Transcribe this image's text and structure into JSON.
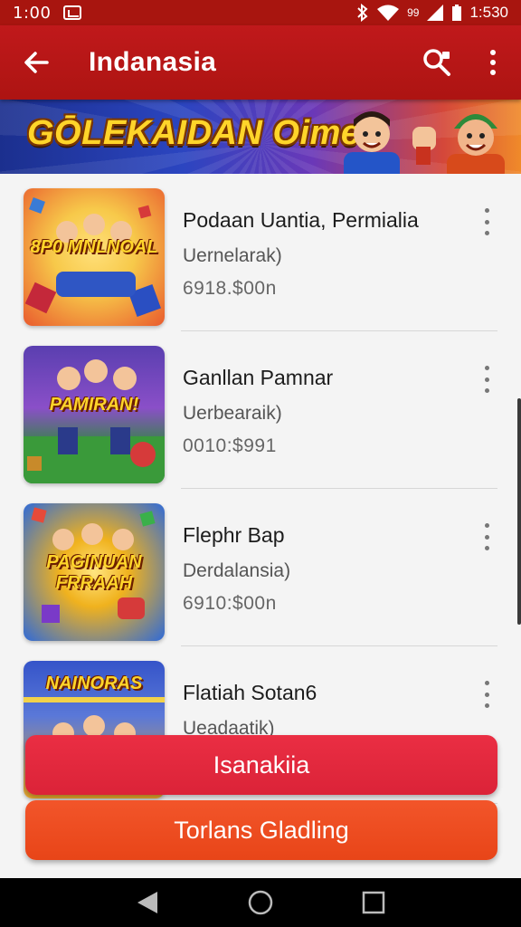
{
  "status": {
    "time_left": "1:00",
    "signal_label": "99",
    "time_right": "1:530"
  },
  "appbar": {
    "title": "Indanasia",
    "icons": [
      "arrow-left-icon",
      "search-icon",
      "more-vert-icon"
    ]
  },
  "banner": {
    "text": "GŌLEKAIDAN Oime"
  },
  "items": [
    {
      "title": "Podaan Uantia, Permialia",
      "subtitle": "Uernelarak)",
      "price": "6918.$00n",
      "thumb_text": "8P0 MNLNOAL",
      "thumb_colors": [
        "#f7c94a",
        "#e95a2d"
      ]
    },
    {
      "title": "Ganllan Pamnar",
      "subtitle": "Uerbearaik)",
      "price": "0010:$991",
      "thumb_text": "PAMIRAN!",
      "thumb_colors": [
        "#5a3fb0",
        "#2e8a3a"
      ]
    },
    {
      "title": "Flephr Bap",
      "subtitle": "Derdalansia)",
      "price": "6910:$00n",
      "thumb_text": "PAGINUAN FRRAAH",
      "thumb_colors": [
        "#2f6ad8",
        "#f0b21e"
      ]
    },
    {
      "title": "Flatiah Sotan6",
      "subtitle": "Ueadaatik)",
      "price": "",
      "thumb_text": "NAINORAS",
      "thumb_colors": [
        "#3554c9",
        "#e7a72a"
      ]
    }
  ],
  "buttons": {
    "primary": "Isanakiia",
    "secondary": "Torlans Gladling"
  },
  "colors": {
    "appbar": "#c0191b",
    "primary_button": "#e52b40",
    "secondary_button": "#ee4e22"
  }
}
